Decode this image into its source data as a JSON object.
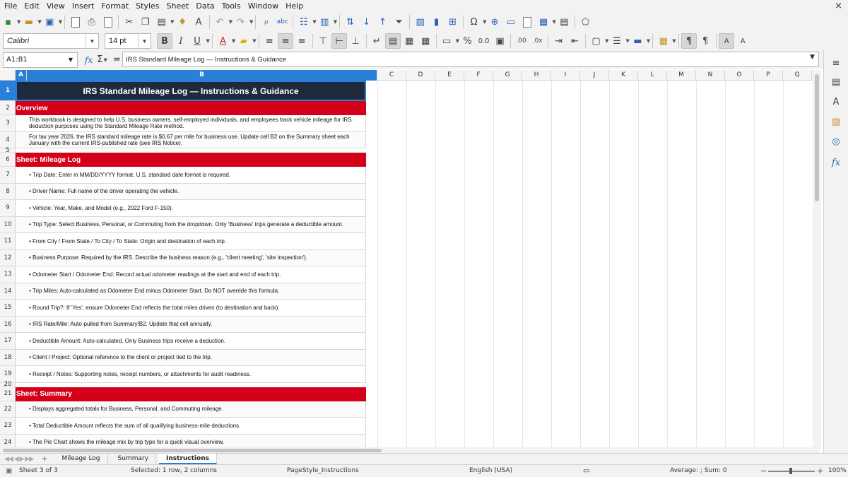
{
  "menu": [
    "File",
    "Edit",
    "View",
    "Insert",
    "Format",
    "Styles",
    "Sheet",
    "Data",
    "Tools",
    "Window",
    "Help"
  ],
  "close_glyph": "×",
  "font": {
    "name": "Calibri",
    "size": "14 pt"
  },
  "namebox": "A1:B1",
  "formula": "IRS Standard Mileage Log — Instructions & Guidance",
  "columns": [
    "A",
    "B",
    "C",
    "D",
    "E",
    "F",
    "G",
    "H",
    "I",
    "J",
    "K",
    "L",
    "M",
    "N",
    "O",
    "P",
    "Q"
  ],
  "rows": [
    {
      "num": "1",
      "kind": "title",
      "text": "IRS Standard Mileage Log — Instructions & Guidance"
    },
    {
      "num": "2",
      "kind": "section",
      "text": "Overview"
    },
    {
      "num": "3",
      "kind": "body",
      "text": "This workbook is designed to help U.S. business owners, self-employed individuals, and employees track vehicle mileage for IRS deduction purposes using the Standard Mileage Rate method."
    },
    {
      "num": "4",
      "kind": "body",
      "text": "For tax year 2026, the IRS standard mileage rate is $0.67 per mile for business use. Update cell B2 on the Summary sheet each January with the current IRS-published rate (see IRS Notice)."
    },
    {
      "num": "5",
      "kind": "blank",
      "text": ""
    },
    {
      "num": "6",
      "kind": "section",
      "text": "Sheet: Mileage Log"
    },
    {
      "num": "7",
      "kind": "body",
      "text": "• Trip Date: Enter in MM/DD/YYYY format. U.S. standard date format is required."
    },
    {
      "num": "8",
      "kind": "body",
      "text": "• Driver Name: Full name of the driver operating the vehicle."
    },
    {
      "num": "9",
      "kind": "body",
      "text": "• Vehicle: Year, Make, and Model (e.g., 2022 Ford F-150)."
    },
    {
      "num": "10",
      "kind": "body",
      "text": "• Trip Type: Select Business, Personal, or Commuting from the dropdown. Only 'Business' trips generate a deductible amount."
    },
    {
      "num": "11",
      "kind": "body",
      "text": "• From City / From State / To City / To State: Origin and destination of each trip."
    },
    {
      "num": "12",
      "kind": "body",
      "text": "• Business Purpose: Required by the IRS. Describe the business reason (e.g., 'client meeting', 'site inspection')."
    },
    {
      "num": "13",
      "kind": "body",
      "text": "• Odometer Start / Odometer End: Record actual odometer readings at the start and end of each trip."
    },
    {
      "num": "14",
      "kind": "body",
      "text": "• Trip Miles: Auto-calculated as Odometer End minus Odometer Start. Do NOT override this formula."
    },
    {
      "num": "15",
      "kind": "body",
      "text": "• Round Trip?: If 'Yes', ensure Odometer End reflects the total miles driven (to destination and back)."
    },
    {
      "num": "16",
      "kind": "body",
      "text": "• IRS Rate/Mile: Auto-pulled from Summary!B2. Update that cell annually."
    },
    {
      "num": "17",
      "kind": "body",
      "text": "• Deductible Amount: Auto-calculated. Only Business trips receive a deduction."
    },
    {
      "num": "18",
      "kind": "body",
      "text": "• Client / Project: Optional reference to the client or project tied to the trip."
    },
    {
      "num": "19",
      "kind": "body",
      "text": "• Receipt / Notes: Supporting notes, receipt numbers, or attachments for audit readiness."
    },
    {
      "num": "20",
      "kind": "blank",
      "text": ""
    },
    {
      "num": "21",
      "kind": "section",
      "text": "Sheet: Summary"
    },
    {
      "num": "22",
      "kind": "body",
      "text": "• Displays aggregated totals for Business, Personal, and Commuting mileage."
    },
    {
      "num": "23",
      "kind": "body",
      "text": "• Total Deductible Amount reflects the sum of all qualifying business-mile deductions."
    },
    {
      "num": "24",
      "kind": "body",
      "text": "• The Pie Chart shows the mileage mix by trip type for a quick visual overview."
    }
  ],
  "tabs": [
    "Mileage Log",
    "Summary",
    "Instructions"
  ],
  "active_tab": "Instructions",
  "status": {
    "sheet": "Sheet 3 of 3",
    "selection": "Selected: 1 row, 2 columns",
    "page_style": "PageStyle_Instructions",
    "language": "English (USA)",
    "sum": "Average: ; Sum: 0",
    "zoom": "100%"
  },
  "colors": {
    "title_bg": "#1e2a3c",
    "section_bg": "#d4001a",
    "selection": "#2a7fd9"
  }
}
